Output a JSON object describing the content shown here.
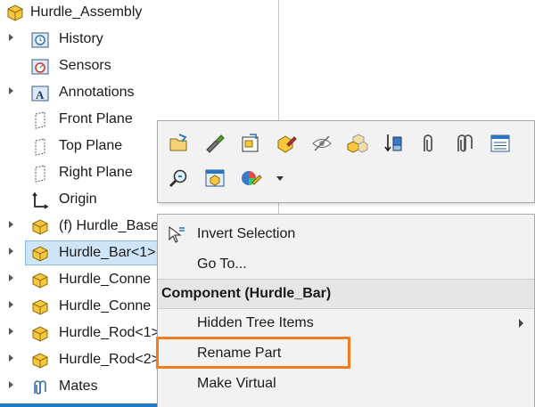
{
  "tree": {
    "root_label": "Hurdle_Assembly",
    "items": [
      {
        "label": "History"
      },
      {
        "label": "Sensors"
      },
      {
        "label": "Annotations"
      },
      {
        "label": "Front Plane"
      },
      {
        "label": "Top Plane"
      },
      {
        "label": "Right Plane"
      },
      {
        "label": "Origin"
      },
      {
        "label": "(f) Hurdle_Base"
      },
      {
        "label": "Hurdle_Bar<1>"
      },
      {
        "label": "Hurdle_Conne"
      },
      {
        "label": "Hurdle_Conne"
      },
      {
        "label": "Hurdle_Rod<1>"
      },
      {
        "label": "Hurdle_Rod<2>"
      },
      {
        "label": "Mates"
      }
    ]
  },
  "toolbar": {
    "icons": [
      "open-part-icon",
      "edit-component-icon",
      "open-drawing-icon",
      "appearance-icon",
      "hide-icon",
      "isolate-icon",
      "move-component-icon",
      "mate-icon",
      "view-mates-icon",
      "properties-icon",
      "zoom-to-selection-icon",
      "component-configuration-icon",
      "appearance-dropdown-icon"
    ]
  },
  "menu": {
    "invert_selection": "Invert Selection",
    "go_to": "Go To...",
    "section_header": "Component (Hurdle_Bar)",
    "hidden_tree_items": "Hidden Tree Items",
    "rename_part": "Rename Part",
    "make_virtual": "Make Virtual"
  },
  "colors": {
    "selection_bg": "#cde5f7",
    "highlight_border": "#f07d22",
    "accent": "#1f7ac8"
  }
}
